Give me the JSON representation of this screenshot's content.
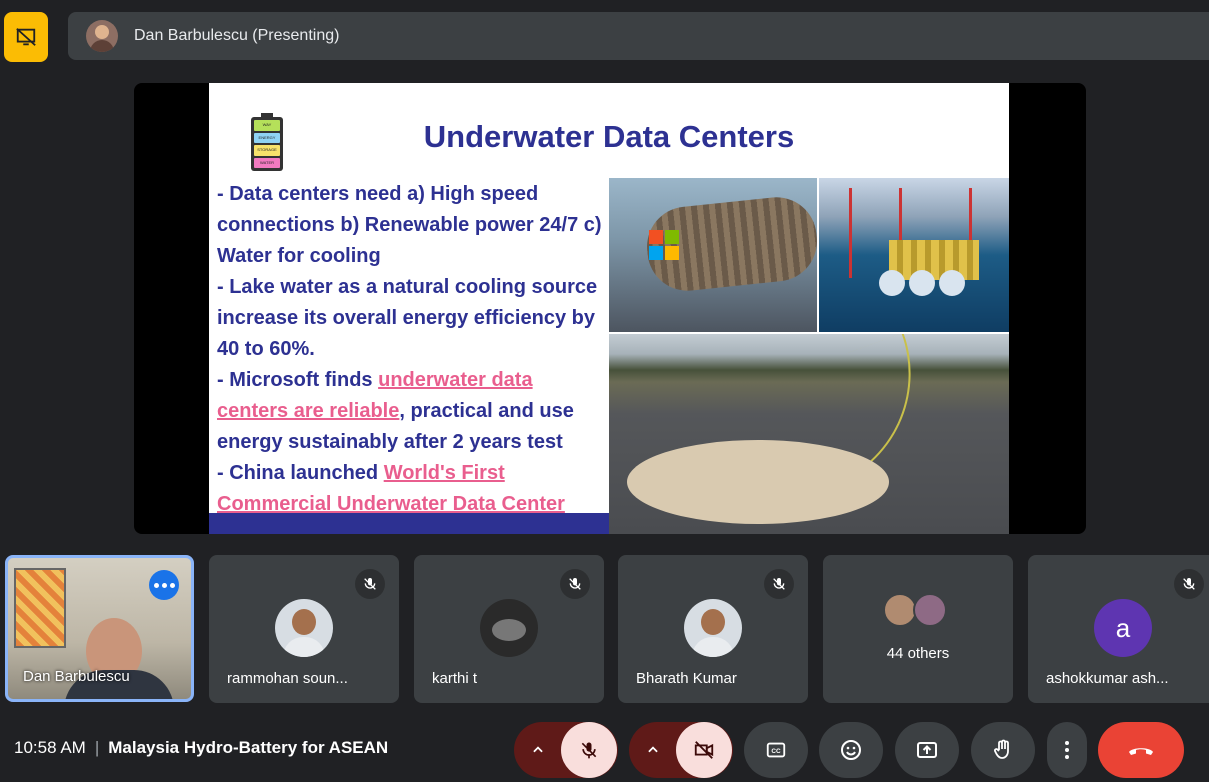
{
  "header": {
    "presenter_label": "Dan Barbulescu (Presenting)"
  },
  "slide": {
    "title": "Underwater Data Centers",
    "battery_labels": [
      "WAY",
      "ENERGY",
      "STORAGE",
      "WATER"
    ],
    "bullet1": "- Data centers need a) High speed connections b) Renewable power 24/7 c) Water for cooling",
    "bullet2": "- Lake water as a natural cooling source increase its overall energy efficiency by 40 to 60%.",
    "bullet3_prefix": "- Microsoft finds ",
    "bullet3_link": "underwater data centers are reliable",
    "bullet3_suffix": ", practical and use energy sustainably after 2 years test",
    "bullet4_prefix": "- China launched ",
    "bullet4_link": "World's First Commercial Underwater Data Center"
  },
  "participants": [
    {
      "name": "Dan Barbulescu"
    },
    {
      "name": "rammohan soun..."
    },
    {
      "name": "karthi t"
    },
    {
      "name": "Bharath Kumar"
    },
    {
      "name": "44 others"
    },
    {
      "name": "ashokkumar ash...",
      "initial": "a"
    }
  ],
  "footer": {
    "time": "10:58 AM",
    "separator": "|",
    "meeting_title": "Malaysia Hydro-Battery for ASEAN"
  },
  "icons": {
    "hide": "hide-presentation-icon",
    "mic_off": "mic-off-icon",
    "cam_off": "camera-off-icon",
    "captions": "captions-icon",
    "emoji": "emoji-icon",
    "present": "present-screen-icon",
    "hand": "raise-hand-icon",
    "more": "more-options-icon",
    "end": "end-call-icon"
  },
  "colors": {
    "accent": "#8ab4f8",
    "highlight": "#fbbc04",
    "danger": "#ea4335",
    "slide_title": "#2d3192",
    "slide_link": "#e95e8e"
  }
}
